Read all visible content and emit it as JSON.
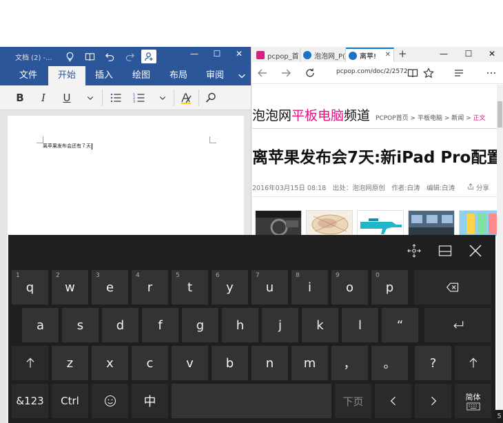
{
  "word": {
    "doc_title": "文档 (2) -...",
    "tabs": [
      "文件",
      "开始",
      "插入",
      "绘图",
      "布局",
      "审阅"
    ],
    "active_tab": "开始",
    "ribbon": {
      "bold": "B",
      "italic": "I",
      "underline": "U"
    },
    "document_text": "离苹果发布会还有７天",
    "window_controls": {
      "minimize": "—",
      "maximize": "☐",
      "close": "✕"
    }
  },
  "edge": {
    "tabs": [
      {
        "title": "pcpop_首",
        "favicon_color": "#d3237c"
      },
      {
        "title": "泡泡网_P(",
        "favicon_color": "#1a73c9"
      },
      {
        "title": "离苹!",
        "favicon_color": "#1a73c9"
      }
    ],
    "new_tab": "+",
    "url": "pcpop.com/doc/2/2572",
    "window_controls": {
      "minimize": "—",
      "maximize": "☐",
      "close": "✕"
    },
    "page": {
      "logo_a": "泡泡网",
      "logo_b": "平板电脑",
      "logo_c": "频道",
      "breadcrumb": "PCPOP首页 > 平板电脑 > 新闻 > ",
      "breadcrumb_current": "正文",
      "article_title": "离苹果发布会7天:新iPad Pro配置",
      "meta": "2016年03月15日 08:18　出处：泡泡网原创　作者:白涛　编辑:白涛",
      "share": "分享"
    }
  },
  "keyboard": {
    "row1": [
      {
        "k": "q",
        "alt": "1"
      },
      {
        "k": "w",
        "alt": "2"
      },
      {
        "k": "e",
        "alt": "3"
      },
      {
        "k": "r",
        "alt": "4"
      },
      {
        "k": "t",
        "alt": "5"
      },
      {
        "k": "y",
        "alt": "6"
      },
      {
        "k": "u",
        "alt": "7"
      },
      {
        "k": "i",
        "alt": "8"
      },
      {
        "k": "o",
        "alt": "9"
      },
      {
        "k": "p",
        "alt": "0"
      }
    ],
    "row2": [
      "a",
      "s",
      "d",
      "f",
      "g",
      "h",
      "j",
      "k",
      "l",
      "“"
    ],
    "row3": [
      "z",
      "x",
      "c",
      "v",
      "b",
      "n",
      "m",
      "，",
      "。",
      "?"
    ],
    "numsym": "&123",
    "ctrl": "Ctrl",
    "lang": "中",
    "next_page": "下页",
    "ime_mode": "简体"
  },
  "taskbar_edge_glyph": "5",
  "colors": {
    "word_blue": "#2b579a",
    "edge_accent": "#0078d7",
    "pink": "#e0147f",
    "key_bg": "#333333"
  }
}
